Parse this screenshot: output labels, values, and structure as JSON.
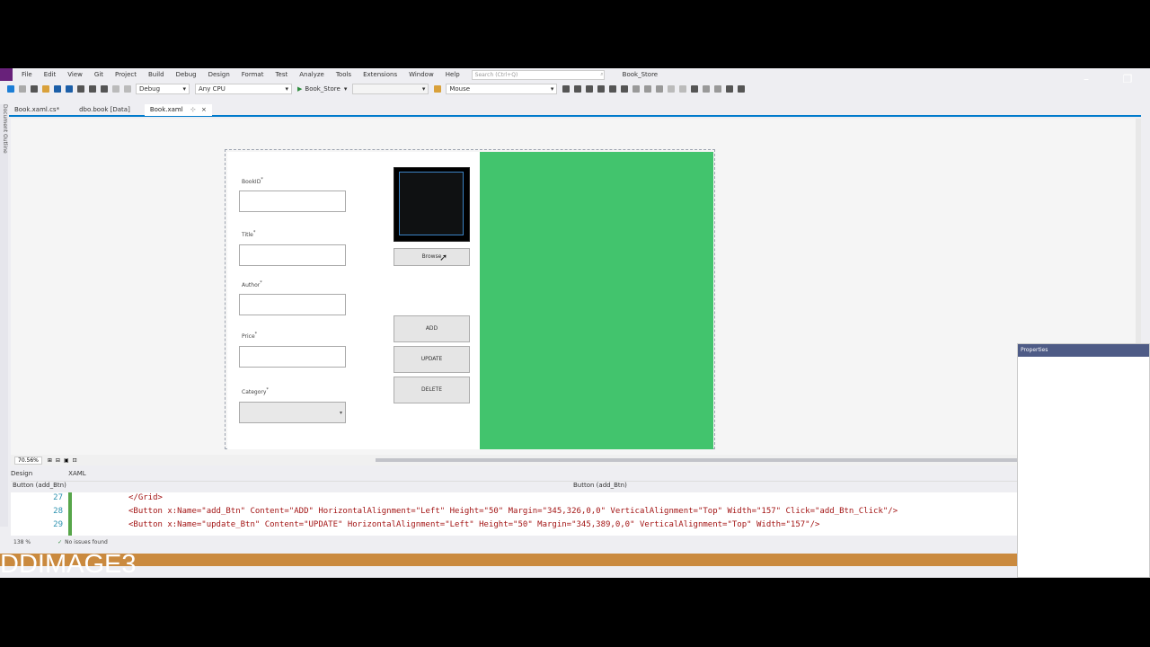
{
  "menu": [
    "File",
    "Edit",
    "View",
    "Git",
    "Project",
    "Build",
    "Debug",
    "Design",
    "Format",
    "Test",
    "Analyze",
    "Tools",
    "Extensions",
    "Window",
    "Help"
  ],
  "search": {
    "placeholder": "Search (Ctrl+Q)"
  },
  "solution_name": "Book_Store",
  "toolbar": {
    "configuration": "Debug",
    "platform": "Any CPU",
    "start_project": "Book_Store",
    "mode": "Mouse"
  },
  "tabs": [
    {
      "label": "Book.xaml.cs*",
      "active": false
    },
    {
      "label": "dbo.book [Data]",
      "active": false
    },
    {
      "label": "Book.xaml",
      "active": true
    }
  ],
  "left_strip_label": "Document Outline",
  "form": {
    "fields": [
      {
        "label": "BookID",
        "required": "*"
      },
      {
        "label": "Title",
        "required": "*"
      },
      {
        "label": "Author",
        "required": "*"
      },
      {
        "label": "Price",
        "required": "*"
      },
      {
        "label": "Category",
        "required": "*"
      }
    ],
    "combo_arrow": "▾",
    "browse_button": "Browse",
    "add_button": "ADD",
    "update_button": "UPDATE",
    "delete_button": "DELETE"
  },
  "zoom": "70.56%",
  "design_tabs": {
    "design": "Design",
    "xaml": "XAML"
  },
  "breadcrumb_left": "Button (add_Btn)",
  "breadcrumb_right": "Button (add_Btn)",
  "code_lines": [
    {
      "num": "27",
      "text": "</Grid>"
    },
    {
      "num": "28",
      "text": "<Button x:Name=\"add_Btn\" Content=\"ADD\" HorizontalAlignment=\"Left\" Height=\"50\" Margin=\"345,326,0,0\" VerticalAlignment=\"Top\" Width=\"157\" Click=\"add_Btn_Click\"/>"
    },
    {
      "num": "29",
      "text": "<Button x:Name=\"update_Btn\" Content=\"UPDATE\" HorizontalAlignment=\"Left\" Height=\"50\" Margin=\"345,389,0,0\" VerticalAlignment=\"Top\" Width=\"157\"/>"
    }
  ],
  "status": {
    "zoom": "138 %",
    "issues": "No issues found"
  },
  "properties_title": "Properties",
  "overlay_text": "DDIMAGE3",
  "colors": {
    "accent": "#007acc",
    "green_panel": "#42c46d",
    "properties_header": "#4e5b86"
  }
}
